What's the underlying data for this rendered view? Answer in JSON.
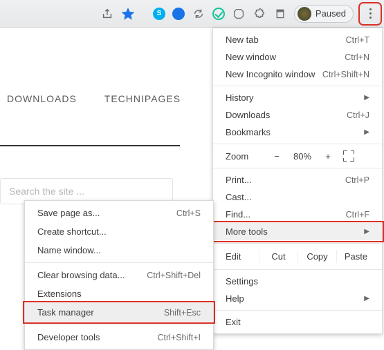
{
  "page": {
    "nav": [
      "DOWNLOADS",
      "TECHNIPAGES"
    ],
    "search_placeholder": "Search the site ..."
  },
  "toolbar": {
    "profile_status": "Paused"
  },
  "menu": {
    "new_tab": {
      "label": "New tab",
      "shortcut": "Ctrl+T"
    },
    "new_window": {
      "label": "New window",
      "shortcut": "Ctrl+N"
    },
    "incognito": {
      "label": "New Incognito window",
      "shortcut": "Ctrl+Shift+N"
    },
    "history": {
      "label": "History"
    },
    "downloads": {
      "label": "Downloads",
      "shortcut": "Ctrl+J"
    },
    "bookmarks": {
      "label": "Bookmarks"
    },
    "zoom": {
      "label": "Zoom",
      "minus": "−",
      "pct": "80%",
      "plus": "+"
    },
    "print": {
      "label": "Print...",
      "shortcut": "Ctrl+P"
    },
    "cast": {
      "label": "Cast..."
    },
    "find": {
      "label": "Find...",
      "shortcut": "Ctrl+F"
    },
    "more_tools": {
      "label": "More tools"
    },
    "edit": {
      "label": "Edit",
      "cut": "Cut",
      "copy": "Copy",
      "paste": "Paste"
    },
    "settings": {
      "label": "Settings"
    },
    "help": {
      "label": "Help"
    },
    "exit": {
      "label": "Exit"
    }
  },
  "submenu": {
    "save_page": {
      "label": "Save page as...",
      "shortcut": "Ctrl+S"
    },
    "shortcut": {
      "label": "Create shortcut..."
    },
    "name_window": {
      "label": "Name window..."
    },
    "clear_data": {
      "label": "Clear browsing data...",
      "shortcut": "Ctrl+Shift+Del"
    },
    "extensions": {
      "label": "Extensions"
    },
    "task_mgr": {
      "label": "Task manager",
      "shortcut": "Shift+Esc"
    },
    "dev_tools": {
      "label": "Developer tools",
      "shortcut": "Ctrl+Shift+I"
    }
  }
}
